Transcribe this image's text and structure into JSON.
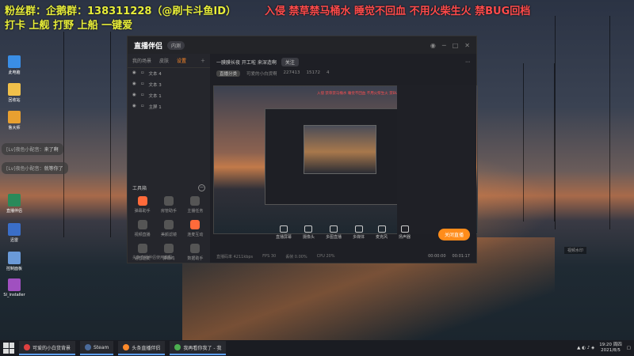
{
  "overlay": {
    "line1": "粉丝群：企鹅群：138311228（@刷卡斗鱼ID）",
    "line1_red": "入侵 禁草禁马桶水 睡觉不回血 不用火柴生火 禁BUG回档",
    "line2": "打卡 上舰 打野 上船 一键爱"
  },
  "desktop_icons": [
    {
      "label": "此电脑",
      "color": "#3a8ee6"
    },
    {
      "label": "回收站",
      "color": "#f0c04a"
    },
    {
      "label": "鲁大师",
      "color": "#e8a030"
    },
    {
      "label": "直播伴侣",
      "color": "#2a8a5a"
    },
    {
      "label": "迅雷",
      "color": "#3a6ec8"
    },
    {
      "label": "控制面板",
      "color": "#6a9ad8"
    },
    {
      "label": "SI_installer",
      "color": "#a050c0"
    }
  ],
  "chat": [
    {
      "user": "[Lv]夜色小配音：",
      "msg": "来了啊"
    },
    {
      "user": "[Lv]夜色小配音：",
      "msg": "就等你了"
    }
  ],
  "app": {
    "title": "直播伴侣",
    "beta": "内测",
    "tabs": [
      "我的场景",
      "皮肤",
      "设置"
    ],
    "active_tab": "设置",
    "scenes": [
      "文本 4",
      "文本 3",
      "文本 1",
      "主屏 1"
    ],
    "tools_title": "工具箱",
    "tools": [
      {
        "label": "弹幕助手",
        "hot": true
      },
      {
        "label": "房管助手",
        "hot": false
      },
      {
        "label": "主播任务",
        "hot": false
      },
      {
        "label": "视频直播",
        "hot": false
      },
      {
        "label": "美颜滤镜",
        "hot": false
      },
      {
        "label": "连麦互动",
        "hot": true
      },
      {
        "label": "语音连麦",
        "hot": false
      },
      {
        "label": "弹幕鸡",
        "hot": false
      },
      {
        "label": "数据助手",
        "hot": false
      }
    ],
    "bottom_tip": "头条直播伴侣使用教程",
    "room_title": "一膜膜长夜  开工啦  来深造啊",
    "follow_btn": "关注",
    "room_level": "直播分类",
    "room_name": "可爱的小白货啊",
    "viewers": "227413",
    "likes": "15172",
    "fans": "4",
    "preview_red": "入侵 禁草禁马桶水 睡觉不回血 不用火柴生火 禁BUG回档",
    "controls": [
      "直播屏幕",
      "摄像头",
      "多图直播",
      "多媒体",
      "麦克风",
      "扬声器"
    ],
    "start_btn": "关闭直播",
    "status": [
      "直播码率 4211kbps",
      "FPS 30",
      "丢帧 0.00%",
      "CPU 20%"
    ],
    "status_right": [
      "00:00:00",
      "00:01:17"
    ]
  },
  "watermark": "视频水印",
  "taskbar": {
    "items": [
      {
        "label": "可爱的小白货背景",
        "color": "#e04040"
      },
      {
        "label": "Steam",
        "color": "#1b2838"
      },
      {
        "label": "头条直播伴侣",
        "color": "#ff8a2a"
      },
      {
        "label": "我再看你我了 - 我",
        "color": "#4caf50"
      }
    ],
    "time": "19:20 周四",
    "date": "2021/8/5"
  }
}
